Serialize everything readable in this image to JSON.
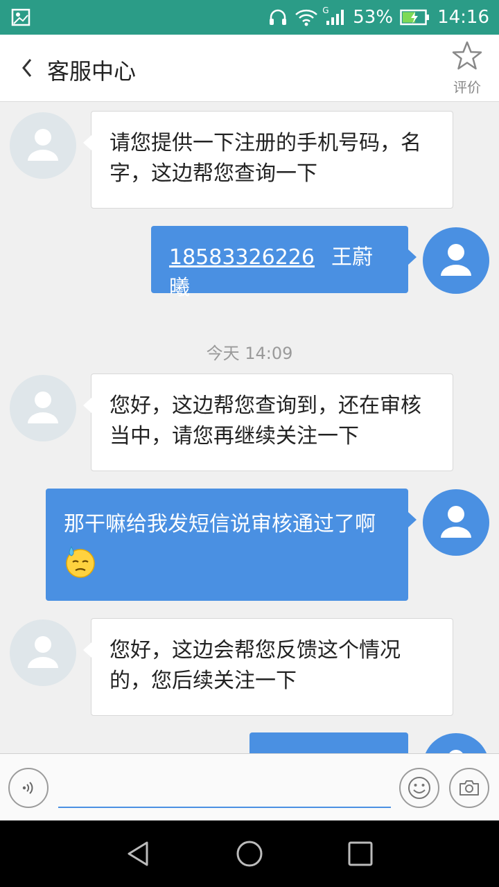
{
  "status_bar": {
    "network_type": "G",
    "battery_percent": "53%",
    "time": "14:16",
    "icons": [
      "image-icon",
      "headphones-icon",
      "wifi-icon",
      "signal-icon",
      "battery-charging-icon"
    ]
  },
  "header": {
    "back_icon": "chevron-left-icon",
    "title": "客服中心",
    "rate_icon": "star-icon",
    "rate_label": "评价"
  },
  "messages": [
    {
      "sender": "agent",
      "text": "请您提供一下注册的手机号码，名字，这边帮您查询一下"
    },
    {
      "sender": "user",
      "phone": "18583326226",
      "name": "王蔚曦"
    },
    {
      "sender": "agent",
      "text": "您好，这边帮您查询到，还在审核当中，请您再继续关注一下"
    },
    {
      "sender": "user",
      "text": "那干嘛给我发短信说审核通过了啊",
      "emoji": "sweat-emoji"
    },
    {
      "sender": "agent",
      "text": "您好，这边会帮您反馈这个情况的，您后续关注一下"
    }
  ],
  "timestamp": "今天 14:09",
  "input_bar": {
    "voice_icon": "voice-icon",
    "input_value": "",
    "emoji_icon": "smiley-icon",
    "camera_icon": "camera-icon"
  },
  "colors": {
    "status_bar": "#2b9c87",
    "user_bubble": "#4a90e2",
    "agent_avatar": "#dfe6ea"
  }
}
